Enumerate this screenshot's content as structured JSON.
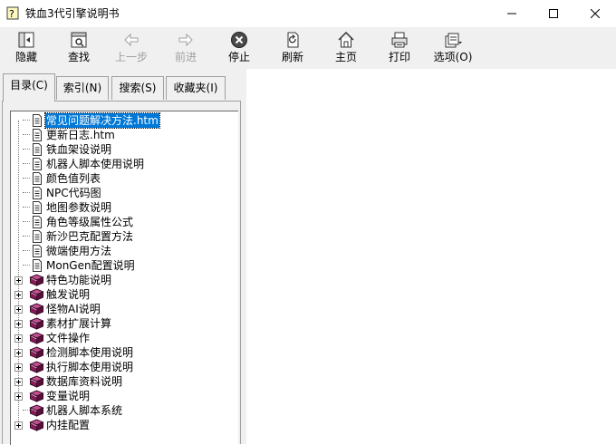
{
  "window": {
    "title": "铁血3代引擎说明书"
  },
  "toolbar": {
    "hide": "隐藏",
    "find": "查找",
    "back": "上一步",
    "forward": "前进",
    "stop": "停止",
    "refresh": "刷新",
    "home": "主页",
    "print": "打印",
    "options": "选项(O)"
  },
  "tabs": {
    "contents": "目录(C)",
    "index": "索引(N)",
    "search": "搜索(S)",
    "favorites": "收藏夹(I)"
  },
  "tree": {
    "pages": [
      "常见问题解决方法.htm",
      "更新日志.htm",
      "铁血架设说明",
      "机器人脚本使用说明",
      "颜色值列表",
      "NPC代码图",
      "地图参数说明",
      "角色等级属性公式",
      "新沙巴克配置方法",
      "微端使用方法",
      "MonGen配置说明"
    ],
    "books": [
      {
        "label": "特色功能说明",
        "expandable": true
      },
      {
        "label": "触发说明",
        "expandable": true
      },
      {
        "label": "怪物AI说明",
        "expandable": true
      },
      {
        "label": "素材扩展计算",
        "expandable": true
      },
      {
        "label": "文件操作",
        "expandable": true
      },
      {
        "label": "检测脚本使用说明",
        "expandable": true
      },
      {
        "label": "执行脚本使用说明",
        "expandable": true
      },
      {
        "label": "数据库资料说明",
        "expandable": true
      },
      {
        "label": "变量说明",
        "expandable": true
      },
      {
        "label": "机器人脚本系统",
        "expandable": false
      },
      {
        "label": "内挂配置",
        "expandable": true
      }
    ]
  },
  "colors": {
    "selection": "#0078d7",
    "book": "#8b1a5a"
  }
}
